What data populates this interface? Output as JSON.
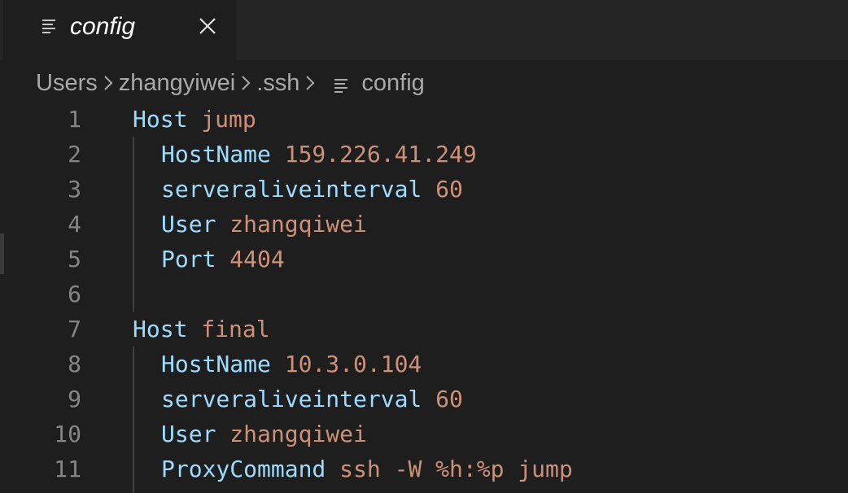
{
  "tab": {
    "label": "config",
    "icon": "lines-file-icon",
    "close_icon": "close-icon"
  },
  "breadcrumb": {
    "items": [
      "Users",
      "zhangyiwei",
      ".ssh",
      "config"
    ],
    "separator_icon": "chevron-right-icon"
  },
  "editor": {
    "lines": [
      {
        "number": "1",
        "key": "Host",
        "value": "jump",
        "indent": 0
      },
      {
        "number": "2",
        "key": "HostName",
        "value": "159.226.41.249",
        "indent": 1
      },
      {
        "number": "3",
        "key": "serveraliveinterval",
        "value": "60",
        "indent": 1
      },
      {
        "number": "4",
        "key": "User",
        "value": "zhangqiwei",
        "indent": 1
      },
      {
        "number": "5",
        "key": "Port",
        "value": "4404",
        "indent": 1
      },
      {
        "number": "6",
        "key": "",
        "value": "",
        "indent": 1
      },
      {
        "number": "7",
        "key": "Host",
        "value": "final",
        "indent": 0
      },
      {
        "number": "8",
        "key": "HostName",
        "value": "10.3.0.104",
        "indent": 1
      },
      {
        "number": "9",
        "key": "serveraliveinterval",
        "value": "60",
        "indent": 1
      },
      {
        "number": "10",
        "key": "User",
        "value": "zhangqiwei",
        "indent": 1
      },
      {
        "number": "11",
        "key": "ProxyCommand",
        "value": "ssh -W %h:%p jump",
        "indent": 1
      }
    ]
  },
  "colors": {
    "background": "#1e1e1e",
    "tabbar": "#252526",
    "keyword": "#9cdcfe",
    "value": "#ce9178",
    "line_number": "#858585",
    "breadcrumb_text": "#a9a9a9"
  }
}
